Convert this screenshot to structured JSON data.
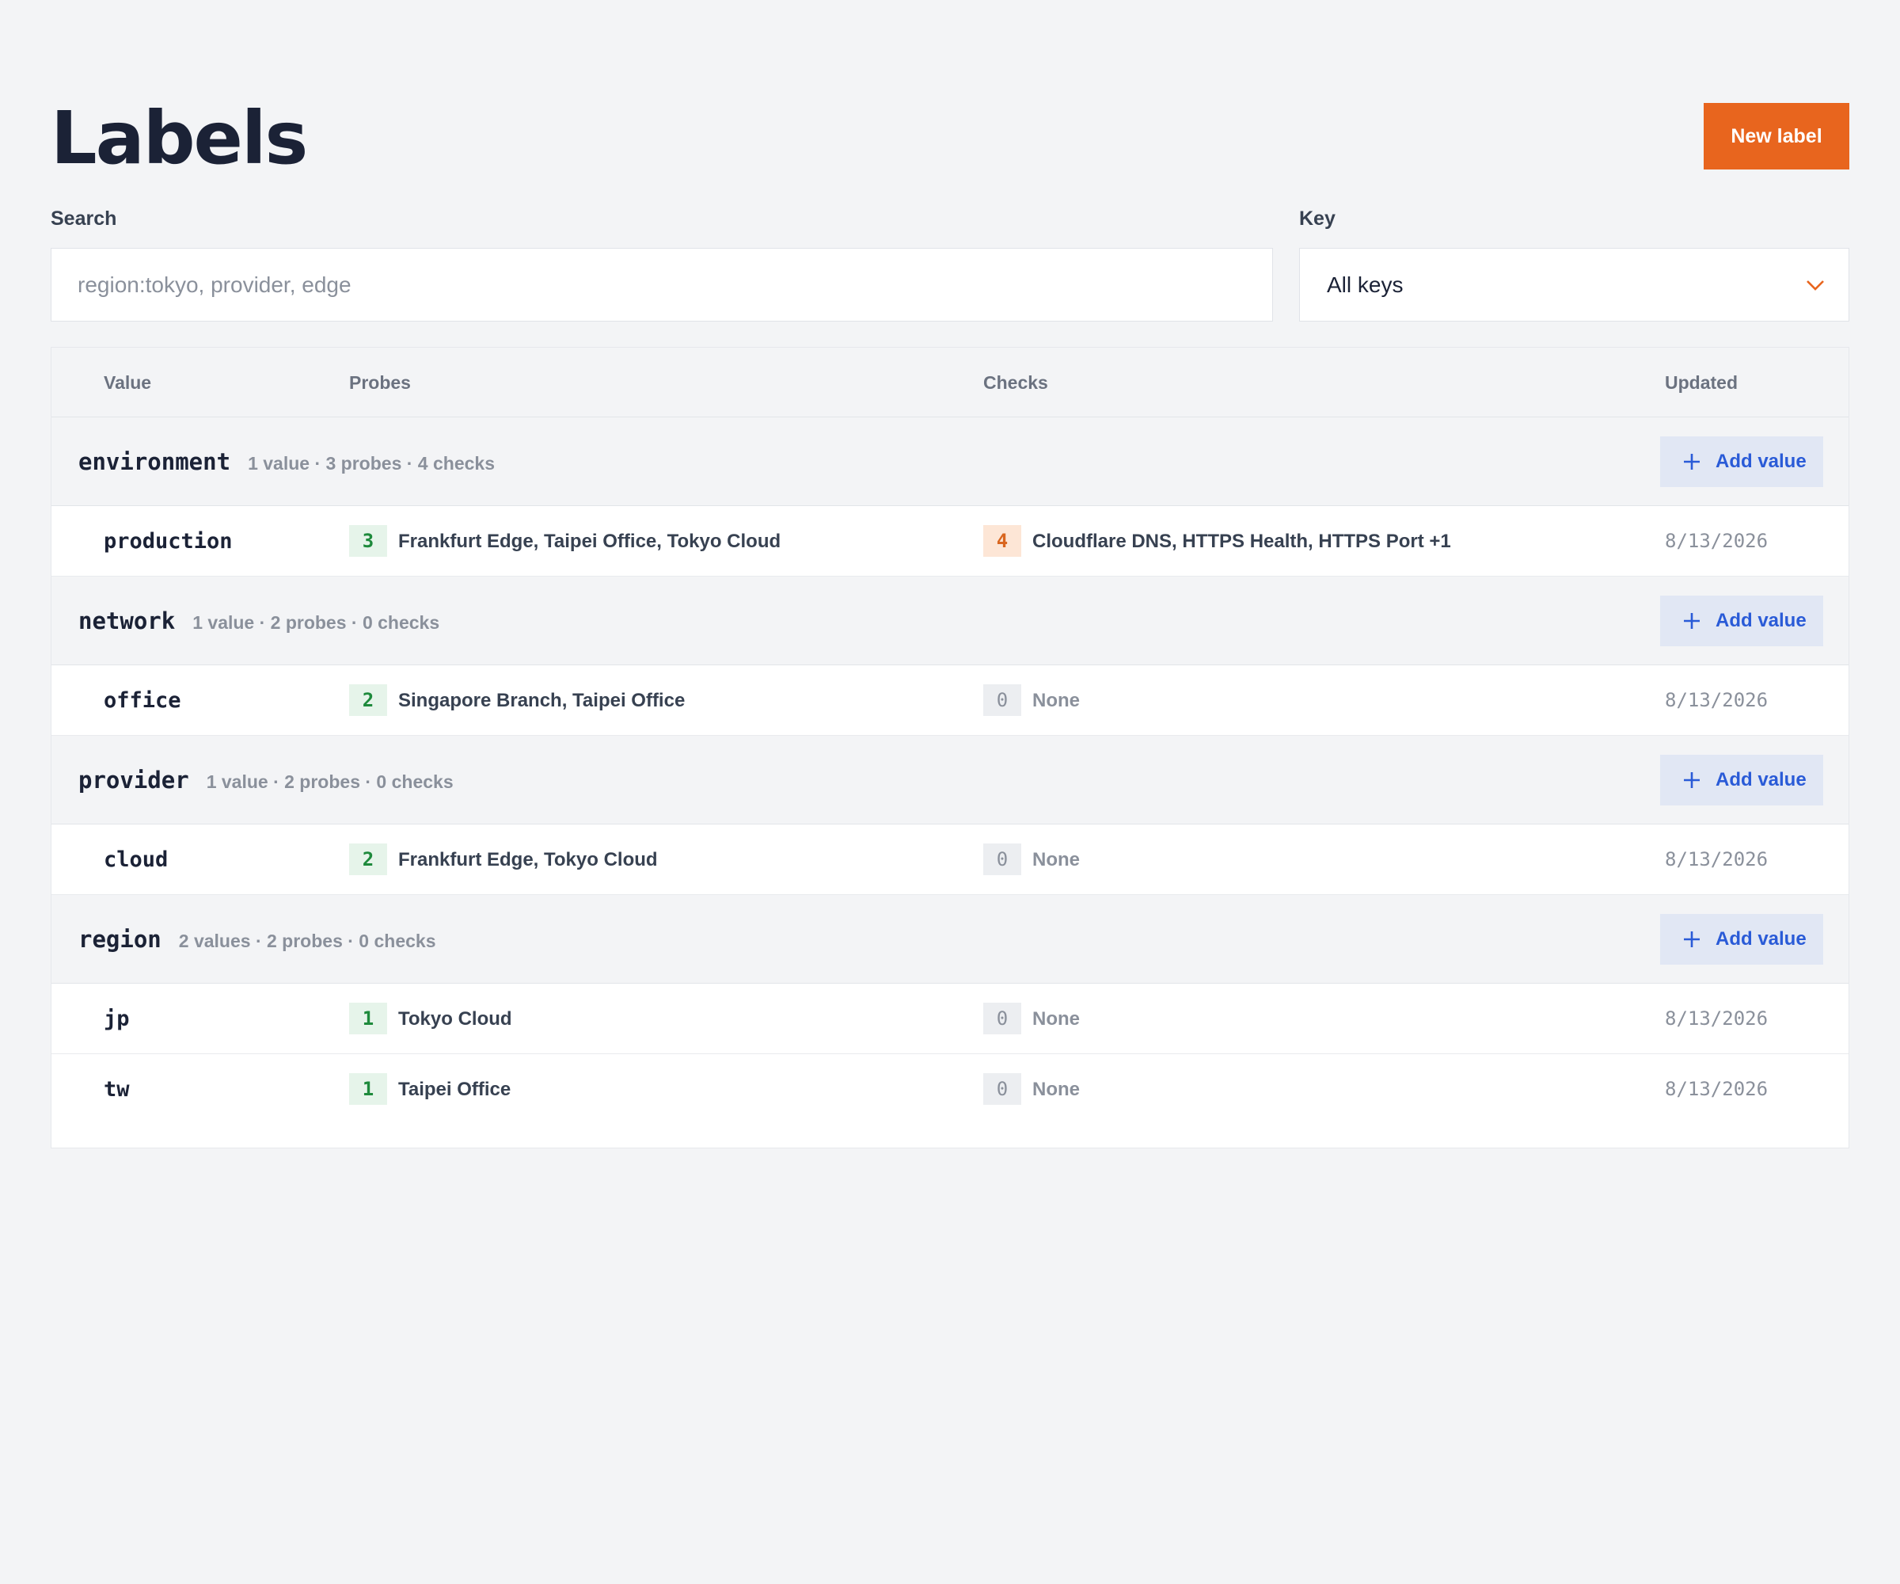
{
  "header": {
    "title": "Labels",
    "new_label_button": "New label"
  },
  "filters": {
    "search_label": "Search",
    "search_placeholder": "region:tokyo, provider, edge",
    "search_value": "",
    "key_label": "Key",
    "key_selected": "All keys"
  },
  "table": {
    "columns": [
      "Value",
      "Probes",
      "Checks",
      "Updated"
    ],
    "add_value_label": "Add value",
    "groups": [
      {
        "key": "environment",
        "meta": "1 value · 3 probes · 4 checks",
        "values": [
          {
            "name": "production",
            "probe_count": "3",
            "probes": "Frankfurt Edge, Taipei Office, Tokyo Cloud",
            "check_count": "4",
            "checks": "Cloudflare DNS, HTTPS Health, HTTPS Port +1",
            "updated": "8/13/2026"
          }
        ]
      },
      {
        "key": "network",
        "meta": "1 value · 2 probes · 0 checks",
        "values": [
          {
            "name": "office",
            "probe_count": "2",
            "probes": "Singapore Branch, Taipei Office",
            "check_count": "0",
            "checks": "None",
            "updated": "8/13/2026"
          }
        ]
      },
      {
        "key": "provider",
        "meta": "1 value · 2 probes · 0 checks",
        "values": [
          {
            "name": "cloud",
            "probe_count": "2",
            "probes": "Frankfurt Edge, Tokyo Cloud",
            "check_count": "0",
            "checks": "None",
            "updated": "8/13/2026"
          }
        ]
      },
      {
        "key": "region",
        "meta": "2 values · 2 probes · 0 checks",
        "values": [
          {
            "name": "jp",
            "probe_count": "1",
            "probes": "Tokyo Cloud",
            "check_count": "0",
            "checks": "None",
            "updated": "8/13/2026"
          },
          {
            "name": "tw",
            "probe_count": "1",
            "probes": "Taipei Office",
            "check_count": "0",
            "checks": "None",
            "updated": "8/13/2026"
          }
        ]
      }
    ]
  },
  "colors": {
    "accent": "#e8651e",
    "link_blue": "#2a5bd7",
    "badge_green": "#1e8a3c",
    "badge_orange": "#d9661f"
  },
  "icons": {
    "select_chevron": "chevron-down-icon",
    "add_value": "plus-icon"
  }
}
